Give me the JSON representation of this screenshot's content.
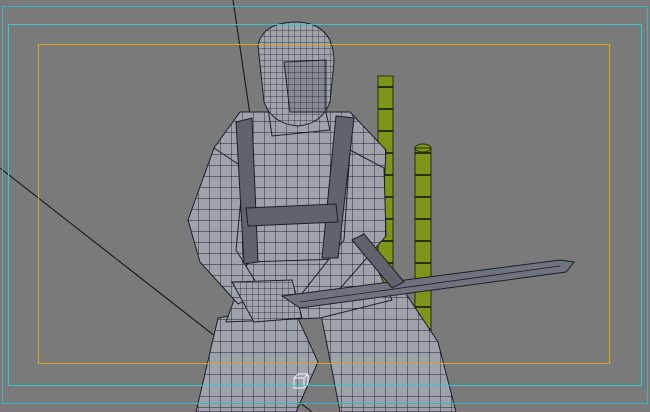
{
  "viewport": {
    "name": "3d-wireframe-viewport",
    "background": "#7a7a7a",
    "mesh_fill": "#9ea2ab",
    "mesh_line": "#1b1f27",
    "bamboo_fill": "#7d951b",
    "bamboo_line": "#263100",
    "sword_fill": "#6e737d",
    "safe_frame_outer": "#33c9cc",
    "safe_frame_inner": "#d9a318",
    "gizmo_color": "#e9e9e9"
  }
}
